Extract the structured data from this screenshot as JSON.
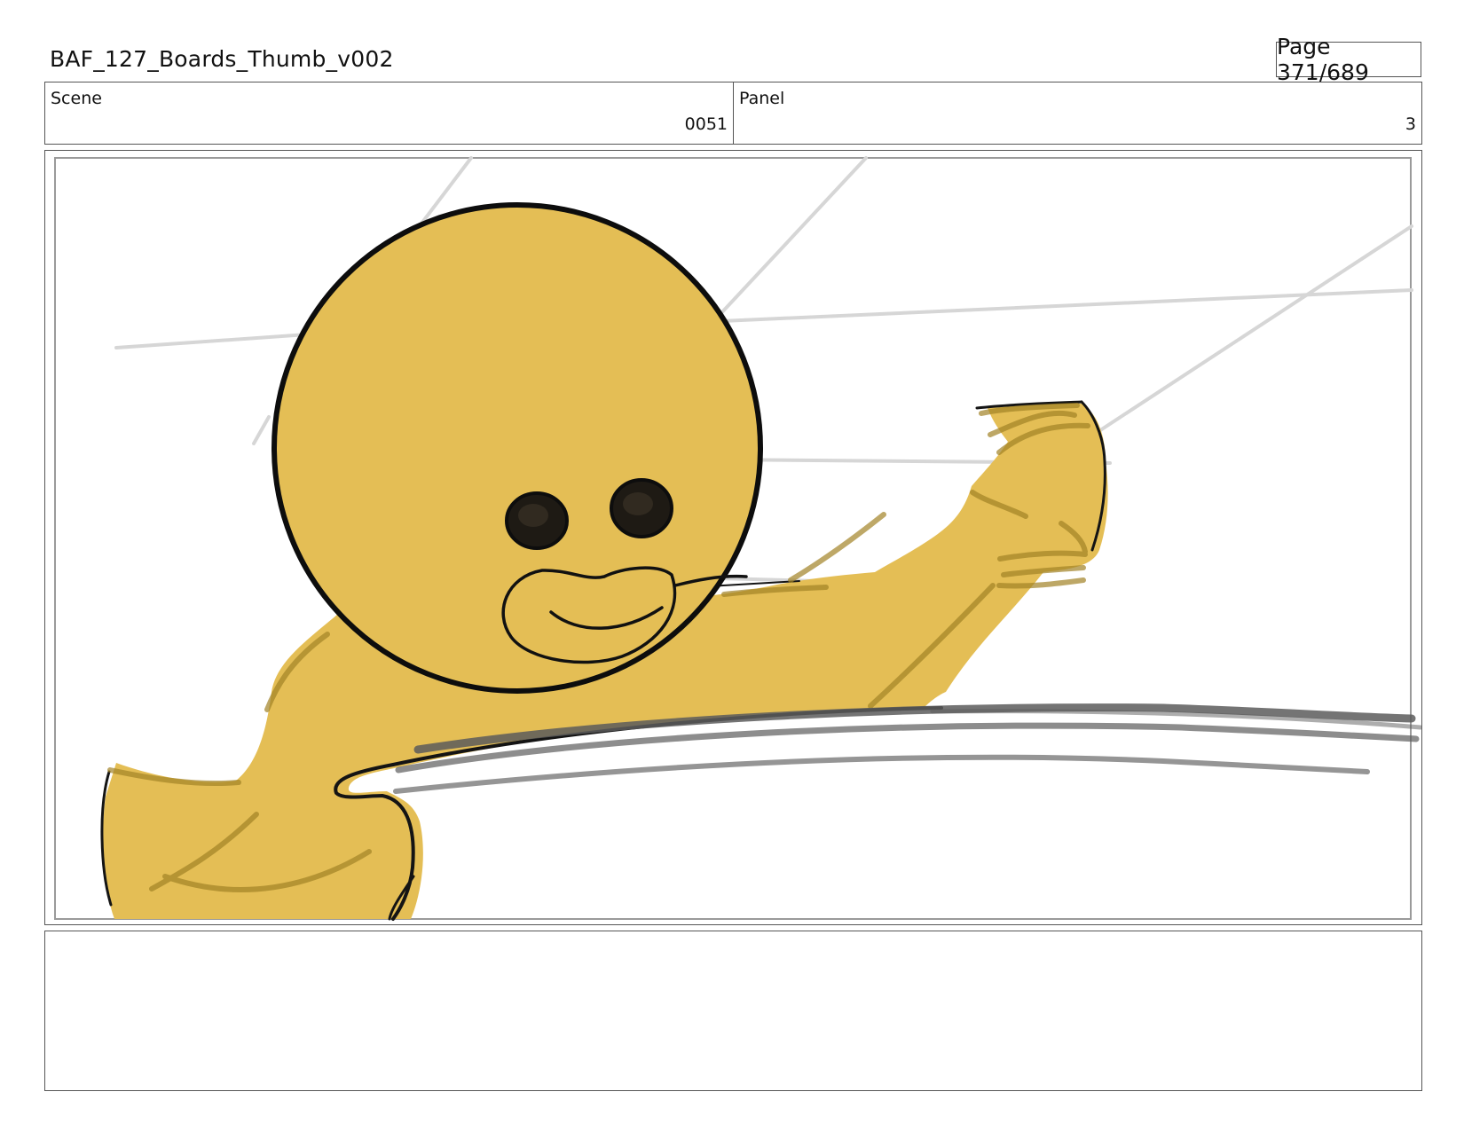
{
  "header": {
    "title": "BAF_127_Boards_Thumb_v002",
    "page": "Page 371/689"
  },
  "info": {
    "scene_label": "Scene",
    "scene_value": "0051",
    "panel_label": "Panel",
    "panel_value": "3"
  },
  "notes": {
    "text": ""
  },
  "colors": {
    "character_fill": "#e4be55",
    "outline": "#111111",
    "sketch_lines": "#d4d4d4",
    "speed_lines": "#5c5c5c",
    "border": "#555555"
  }
}
